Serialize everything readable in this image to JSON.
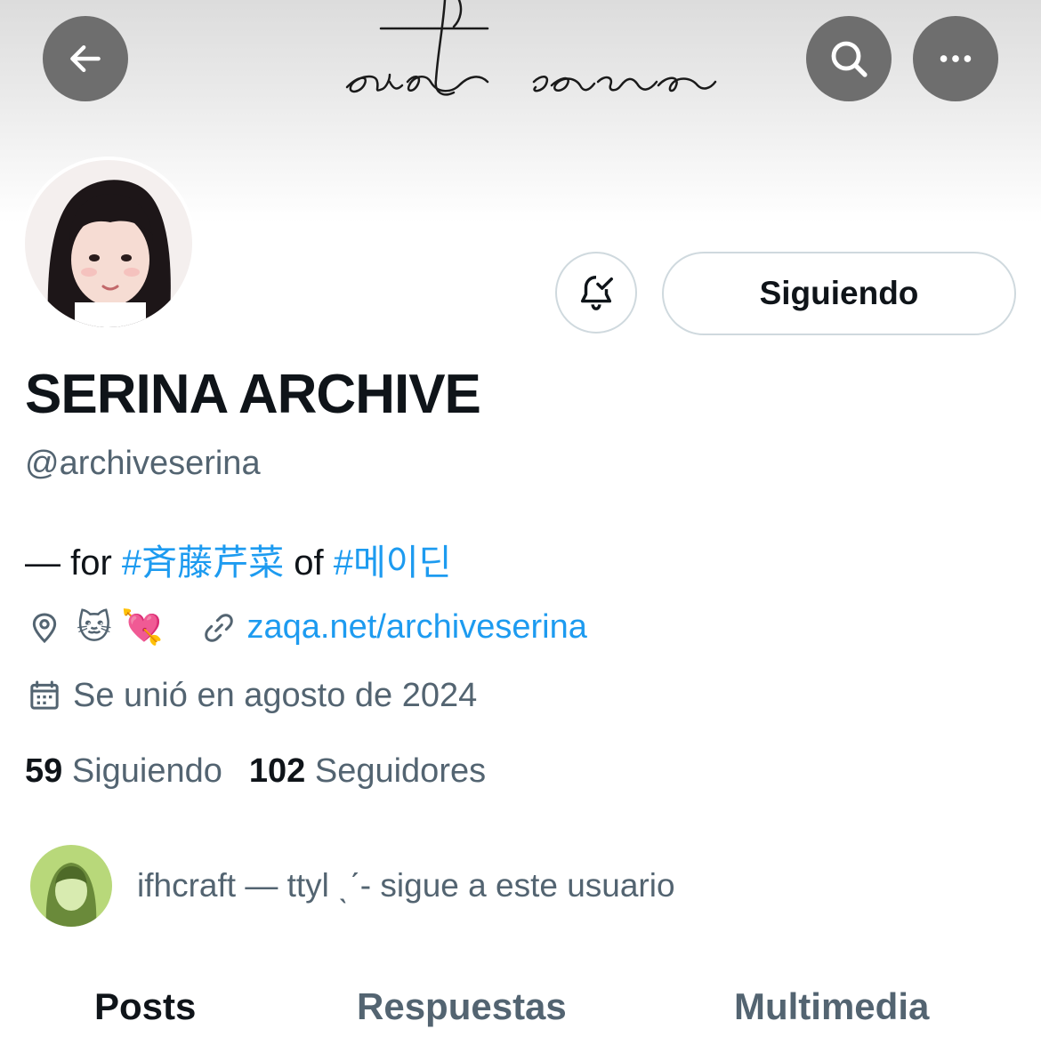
{
  "header": {
    "banner_logo_icon": "saito-serina-script-logo",
    "back_icon": "arrow-left-icon",
    "search_icon": "search-icon",
    "more_icon": "more-horizontal-icon",
    "button_bg": "#6e6e6e"
  },
  "profile": {
    "display_name": "SERINA ARCHIVE",
    "handle": "@archiveserina",
    "bio": {
      "prefix": "— for ",
      "hashtag1": "#斉藤芹菜",
      "middle": " of ",
      "hashtag2": "#메이딘"
    },
    "location_emojis": "🐱 💘",
    "website": "zaqa.net/archiveserina",
    "joined": "Se unió en agosto de 2024",
    "following_count": "59",
    "following_label": "Siguiendo",
    "followers_count": "102",
    "followers_label": "Seguidores"
  },
  "actions": {
    "notify_icon": "bell-check-icon",
    "follow_label": "Siguiendo"
  },
  "followed_by": {
    "text": "ifhcraft — ttyl ˎˊ- sigue a este usuario"
  },
  "tabs": [
    {
      "label": "Posts",
      "active": true
    },
    {
      "label": "Respuestas",
      "active": false
    },
    {
      "label": "Multimedia",
      "active": false
    }
  ],
  "colors": {
    "accent": "#1d9bf0",
    "text_primary": "#0f1419",
    "text_secondary": "#536471",
    "border": "#cfd9de"
  }
}
